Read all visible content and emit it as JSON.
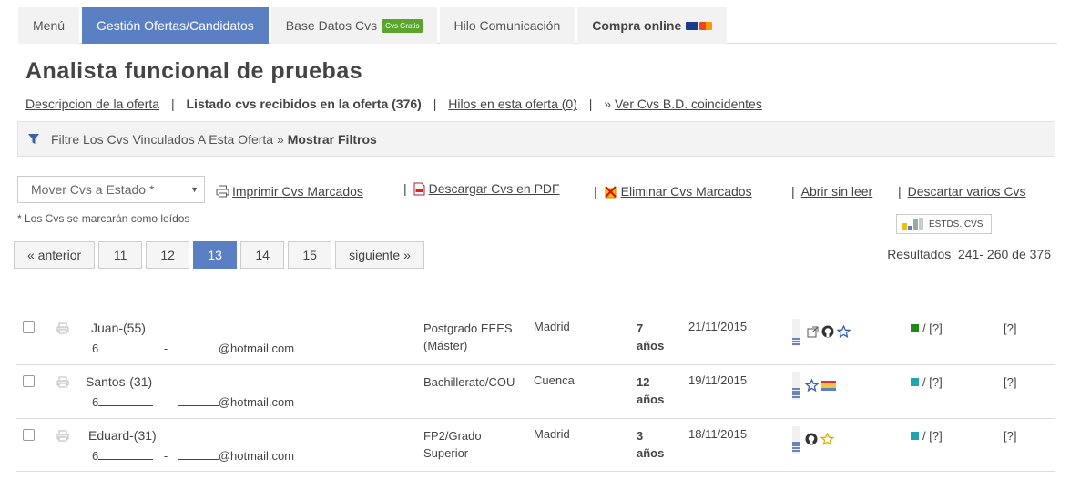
{
  "tabs": [
    {
      "label": "Menú"
    },
    {
      "label": "Gestión Ofertas/Candidatos"
    },
    {
      "label": "Base Datos Cvs",
      "badge": "Cvs Gratis"
    },
    {
      "label": "Hilo Comunicación"
    },
    {
      "label": "Compra online"
    }
  ],
  "page": {
    "title": "Analista funcional de pruebas"
  },
  "subnav": {
    "link1": "Descripcion de la oferta",
    "current": "Listado cvs recibidos en la oferta (376)",
    "link2": "Hilos en esta oferta (0)",
    "link3_prefix": "»",
    "link3": "Ver Cvs B.D. coincidentes"
  },
  "filter": {
    "text": "Filtre Los Cvs Vinculados A Esta Oferta »",
    "show": "Mostrar Filtros"
  },
  "actions": {
    "move_select": "Mover Cvs a Estado *",
    "note": "* Los Cvs se marcarán como leídos",
    "print": "Imprimir Cvs Marcados",
    "pdf": "Descargar Cvs en PDF",
    "delete": "Eliminar Cvs Marcados",
    "unread": "Abrir sin leer",
    "discard": "Descartar varios Cvs",
    "stats": "ESTDS. CVS"
  },
  "pager": {
    "prev": "« anterior",
    "pages": [
      "11",
      "12",
      "13",
      "14",
      "15"
    ],
    "current": "13",
    "next": "siguiente »"
  },
  "results": "Resultados  241- 260 de 376",
  "colors": {
    "accent": "#5b7fc3",
    "green_badge": "#5ca52d",
    "status_green": "#1a8a1a",
    "status_teal": "#21a3b0"
  },
  "candidates": [
    {
      "name": "Juan-(55)",
      "phone_prefix": "6",
      "dash": "-",
      "email_suffix": "@hotmail.com",
      "study": "Postgrado EEES (Máster)",
      "city": "Madrid",
      "years_num": "7",
      "years_unit": "años",
      "date": "21/11/2015",
      "status_color": "#1a8a1a",
      "status_text": "/ [?]",
      "extra": "[?]",
      "icons": [
        "external-link-icon",
        "github-icon",
        "star-outline-icon"
      ]
    },
    {
      "name": "Santos-(31)",
      "phone_prefix": "6",
      "dash": "-",
      "email_suffix": "@hotmail.com",
      "study": "Bachillerato/COU",
      "city": "Cuenca",
      "years_num": "12",
      "years_unit": "años",
      "date": "19/11/2015",
      "status_color": "#21a3b0",
      "status_text": "/ [?]",
      "extra": "[?]",
      "icons": [
        "star-outline-icon",
        "flag-icon"
      ]
    },
    {
      "name": "Eduard-(31)",
      "phone_prefix": "6",
      "dash": "-",
      "email_suffix": "@hotmail.com",
      "study": "FP2/Grado Superior",
      "city": "Madrid",
      "years_num": "3",
      "years_unit": "años",
      "date": "18/11/2015",
      "status_color": "#21a3b0",
      "status_text": "/ [?]",
      "extra": "[?]",
      "icons": [
        "github-icon",
        "star-yellow-icon"
      ]
    }
  ]
}
